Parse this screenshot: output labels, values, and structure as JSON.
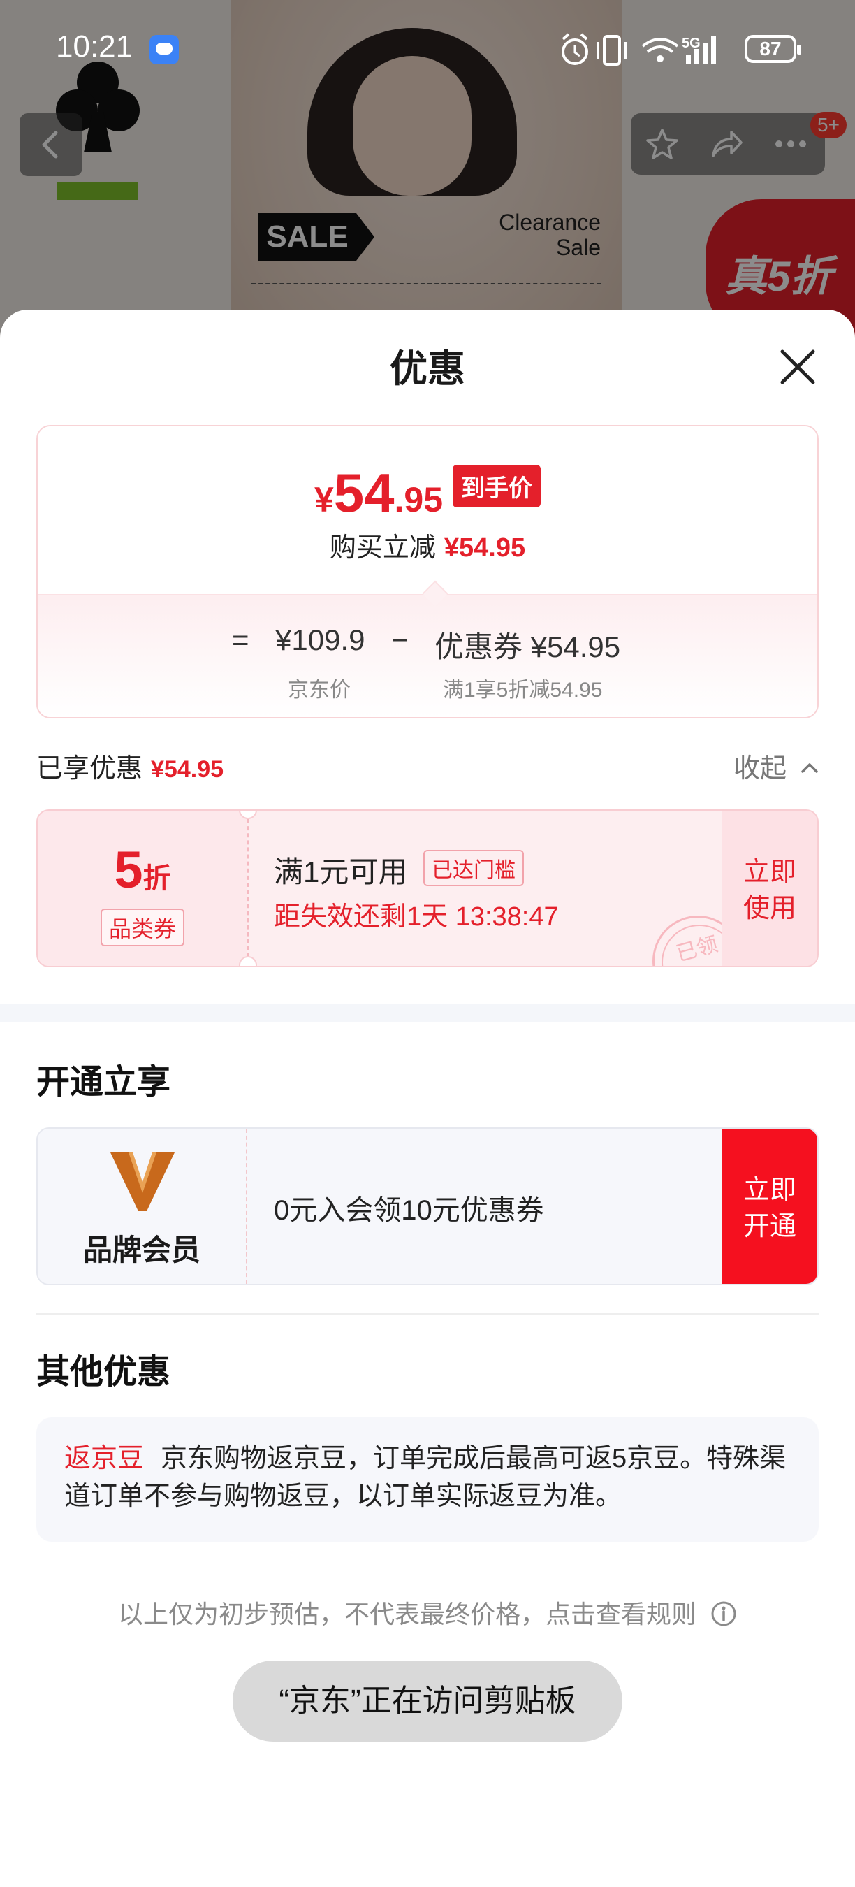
{
  "status_bar": {
    "time": "10:21",
    "battery": "87",
    "network": "5G",
    "icons": [
      "message-icon",
      "alarm-icon",
      "vibrate-icon",
      "wifi-icon",
      "signal-icon",
      "battery-icon"
    ]
  },
  "background_page": {
    "sale_label": "SALE",
    "clearance_text": "Clearance Sale",
    "badge_text": "真5折",
    "cart_badge": "5+"
  },
  "sheet": {
    "title": "优惠",
    "price": {
      "yen": "¥",
      "integer": "54",
      "decimal": ".95",
      "tag": "到手价",
      "subtitle": "购买立减",
      "subtitle_amount": "¥54.95"
    },
    "breakdown": {
      "equals": "=",
      "jd_price": "¥109.9",
      "jd_price_caption": "京东价",
      "minus": "−",
      "coupon": "优惠券 ¥54.95",
      "coupon_caption": "满1享5折减54.95"
    },
    "enjoyed": {
      "label": "已享优惠",
      "amount": "¥54.95",
      "collapse": "收起"
    },
    "coupon_card": {
      "discount_number": "5",
      "discount_unit": "折",
      "type": "品类券",
      "condition": "满1元可用",
      "status": "已达门槛",
      "expiry": "距失效还剩1天 13:38:47",
      "stamp": "已领",
      "action": "立即使用"
    },
    "open_section": {
      "title": "开通立享",
      "member_name": "品牌会员",
      "offer": "0元入会领10元优惠券",
      "action": "立即开通"
    },
    "other_section": {
      "title": "其他优惠",
      "tag": "返京豆",
      "text": "京东购物返京豆，订单完成后最高可返5京豆。特殊渠道订单不参与购物返豆，以订单实际返豆为准。"
    },
    "disclaimer": "以上仅为初步预估，不代表最终价格，点击查看规则",
    "toast": "“京东”正在访问剪贴板"
  },
  "colors": {
    "accent_red": "#e4202b",
    "button_red": "#f5101f",
    "member_gold": "#c8691c"
  }
}
